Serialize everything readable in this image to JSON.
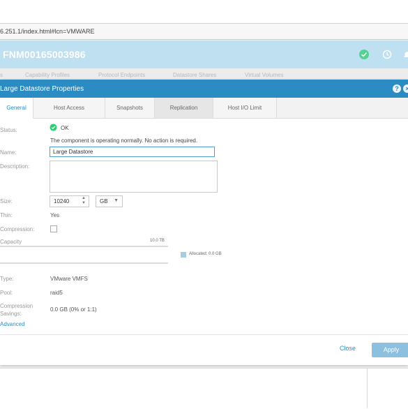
{
  "browser": {
    "url": "6.251.1/index.html#lcn=VMWARE"
  },
  "app": {
    "title": "FNM00165003986",
    "header_icons": [
      "check-circle-icon",
      "history-icon",
      "bell-icon"
    ],
    "background_tabs": [
      "s",
      "Capability Profiles",
      "Protocol Endpoints",
      "Datastore Shares",
      "Virtual Volumes"
    ]
  },
  "dialog": {
    "title": "Large Datastore Properties",
    "title_icons": [
      "help-icon",
      "close-icon"
    ],
    "tabs": [
      {
        "label": "General",
        "active": true
      },
      {
        "label": "Host Access",
        "active": false
      },
      {
        "label": "Snapshots",
        "active": false
      },
      {
        "label": "Replication",
        "active": false
      },
      {
        "label": "Host I/O Limit",
        "active": false
      }
    ],
    "status": {
      "label": "Status:",
      "value": "OK",
      "message": "The component is operating normally. No action is required."
    },
    "name": {
      "label": "Name:",
      "value": "Large Datastore"
    },
    "description": {
      "label": "Description:",
      "value": ""
    },
    "size": {
      "label": "Size:",
      "value": "10240",
      "unit": "GB"
    },
    "thin": {
      "label": "Thin:",
      "value": "Yes"
    },
    "compression": {
      "label": "Compression:",
      "checked": false
    },
    "capacity": {
      "label": "Capacity",
      "max_label": "10.0 TB",
      "legend_label": "Allocated: 0.0 GB",
      "allocated_fraction": 0.0,
      "legend_color": "#a8cde3"
    },
    "type": {
      "label": "Type:",
      "value": "VMware VMFS"
    },
    "pool": {
      "label": "Pool:",
      "value": "raid5"
    },
    "savings": {
      "label_line1": "Compression",
      "label_line2": "Savings:",
      "value": "0.0 GB (0% or 1:1)"
    },
    "advanced_link": "Advanced",
    "buttons": {
      "close": "Close",
      "apply": "Apply"
    }
  },
  "colors": {
    "accent": "#2b8cc4",
    "header_bg": "#bfe0f0",
    "status_ok": "#2ecc71",
    "apply_disabled": "#8cc0de"
  }
}
